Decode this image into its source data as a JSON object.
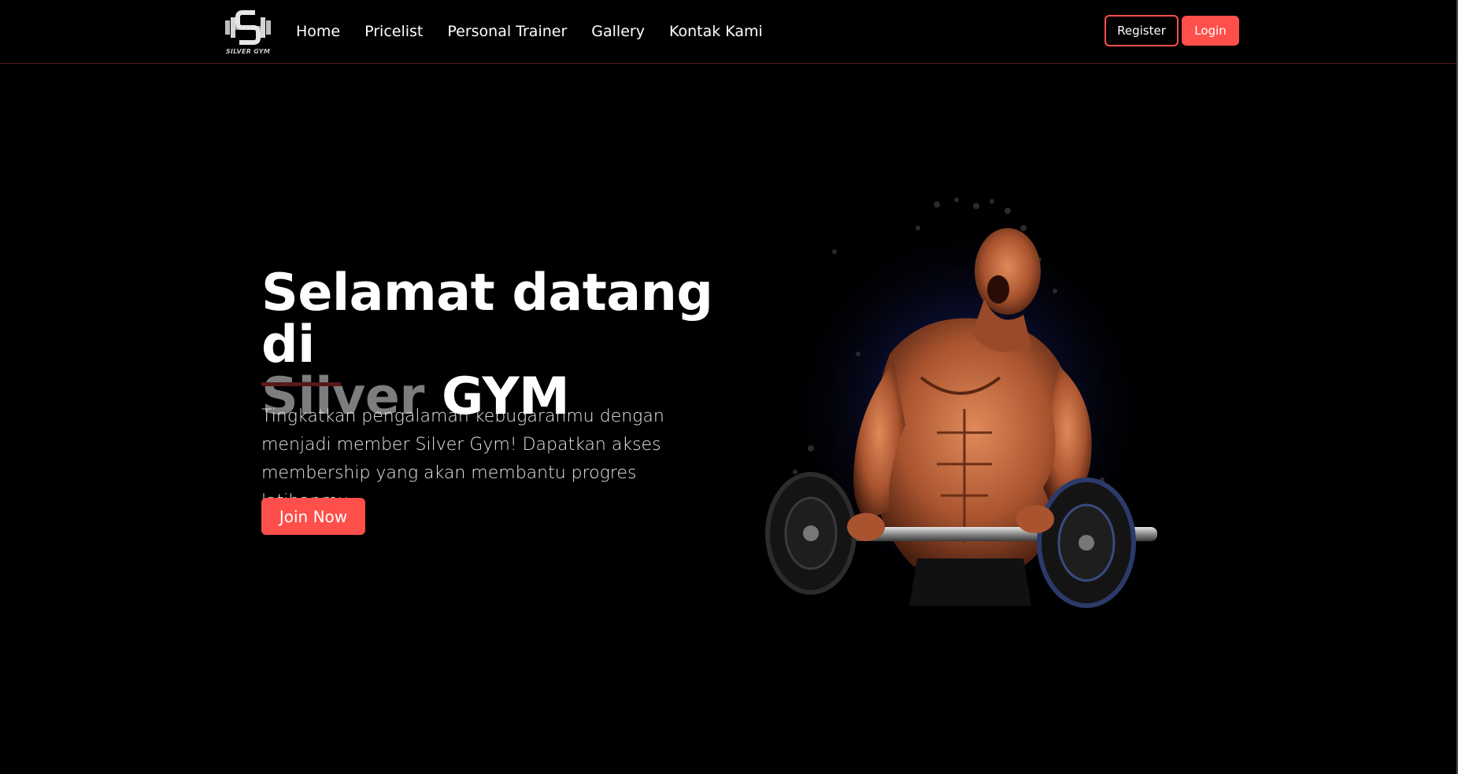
{
  "brand": {
    "logo_caption": "SILVER GYM",
    "accent_color": "#ff4f4a"
  },
  "nav": {
    "items": [
      {
        "label": "Home"
      },
      {
        "label": "Pricelist"
      },
      {
        "label": "Personal Trainer"
      },
      {
        "label": "Gallery"
      },
      {
        "label": "Kontak Kami"
      }
    ],
    "register_label": "Register",
    "login_label": "Login"
  },
  "hero": {
    "title_line1": "Selamat datang di",
    "title_silver": "Silver",
    "title_gym": "GYM",
    "description": "Tingkatkan pengalaman kebugaranmu dengan menjadi member Silver Gym! Dapatkan akses membership yang akan membantu progres latihanmu.",
    "cta_label": "Join Now",
    "image_icon": "bodybuilder-barbell-illustration"
  }
}
